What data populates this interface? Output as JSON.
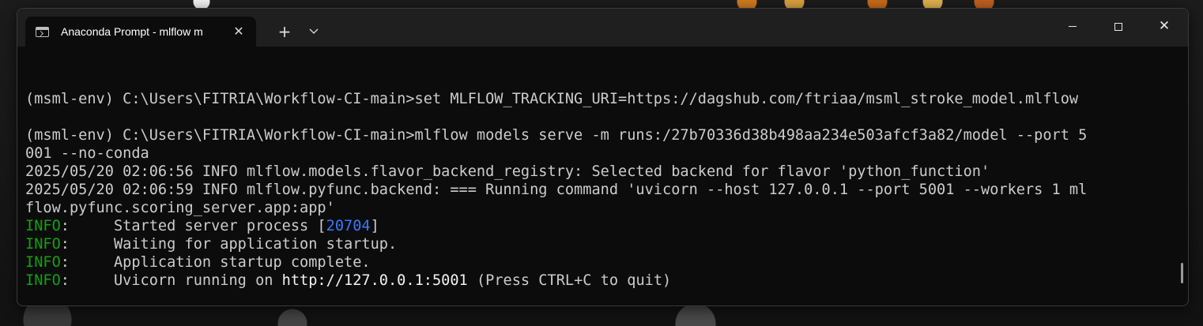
{
  "window": {
    "tab_title": "Anaconda Prompt - mlflow  m",
    "new_tab_label": "+",
    "tab_close": "✕",
    "dropdown": "⌄",
    "close": "✕"
  },
  "terminal": {
    "lines": [
      "",
      "(msml-env) C:\\Users\\FITRIA\\Workflow-CI-main>set MLFLOW_TRACKING_URI=https://dagshub.com/ftriaa/msml_stroke_model.mlflow",
      "",
      "(msml-env) C:\\Users\\FITRIA\\Workflow-CI-main>mlflow models serve -m runs:/27b70336d38b498aa234e503afcf3a82/model --port 5",
      "001 --no-conda",
      "2025/05/20 02:06:56 INFO mlflow.models.flavor_backend_registry: Selected backend for flavor 'python_function'",
      "2025/05/20 02:06:59 INFO mlflow.pyfunc.backend: === Running command 'uvicorn --host 127.0.0.1 --port 5001 --workers 1 ml",
      "flow.pyfunc.scoring_server.app:app'"
    ],
    "info_label": "INFO",
    "info_sep": ":     ",
    "log1_prefix": "Started server process [",
    "log1_pid": "20704",
    "log1_suffix": "]",
    "log2": "Waiting for application startup.",
    "log3": "Application startup complete.",
    "log4_prefix": "Uvicorn running on ",
    "log4_url": "http://127.0.0.1:5001",
    "log4_suffix": " (Press CTRL+C to quit)"
  },
  "colors": {
    "background": "#0c0c0c",
    "titlebar": "#1f1f1f",
    "text": "#cccccc",
    "info": "#13a10e",
    "pid": "#3b78ff"
  }
}
